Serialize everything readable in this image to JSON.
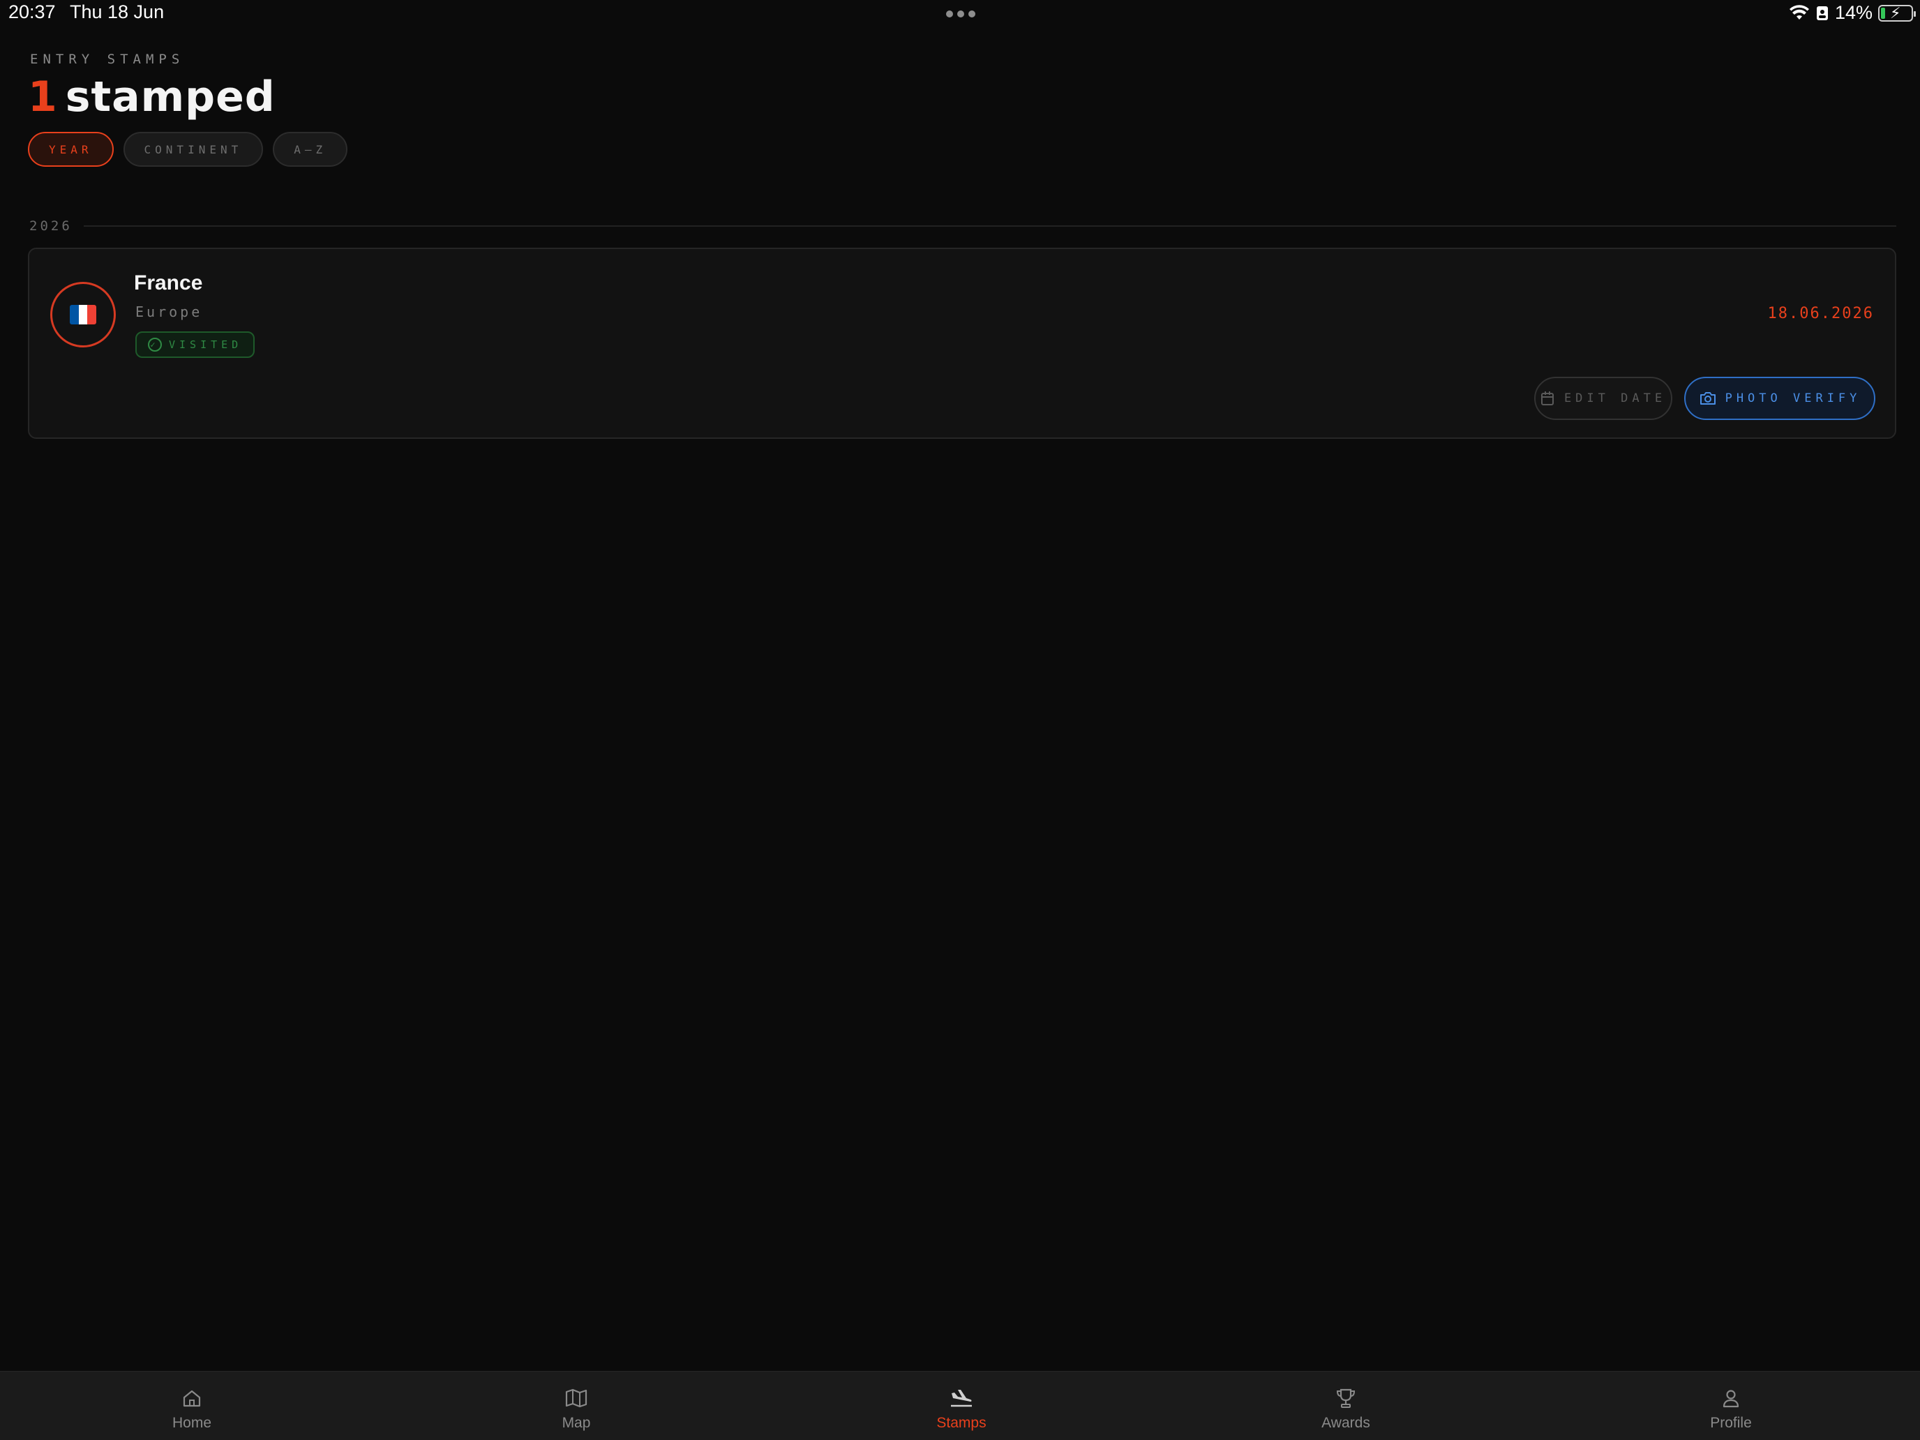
{
  "status_bar": {
    "time": "20:37",
    "date": "Thu 18 Jun",
    "battery": "14%"
  },
  "header": {
    "eyebrow": "ENTRY STAMPS",
    "count": "1",
    "title": "stamped"
  },
  "filters": {
    "items": [
      {
        "label": "YEAR",
        "active": true
      },
      {
        "label": "CONTINENT",
        "active": false
      },
      {
        "label": "A–Z",
        "active": false
      }
    ]
  },
  "groups": [
    {
      "year": "2026",
      "entries": [
        {
          "country": "France",
          "continent": "Europe",
          "status": "VISITED",
          "date": "18.06.2026",
          "flag_colors": [
            "#0055A4",
            "#FFFFFF",
            "#EF4135"
          ],
          "edit_label": "EDIT DATE",
          "photo_label": "PHOTO VERIFY"
        }
      ]
    }
  ],
  "tab_bar": {
    "items": [
      {
        "label": "Home",
        "icon": "home-icon"
      },
      {
        "label": "Map",
        "icon": "map-icon"
      },
      {
        "label": "Stamps",
        "icon": "plane-landing-icon",
        "active": true
      },
      {
        "label": "Awards",
        "icon": "trophy-icon"
      },
      {
        "label": "Profile",
        "icon": "user-icon"
      }
    ]
  },
  "colors": {
    "accent": "#e8401c",
    "visited_green": "#2f8a44",
    "verify_blue": "#4b8fe6",
    "background": "#0b0b0b"
  }
}
